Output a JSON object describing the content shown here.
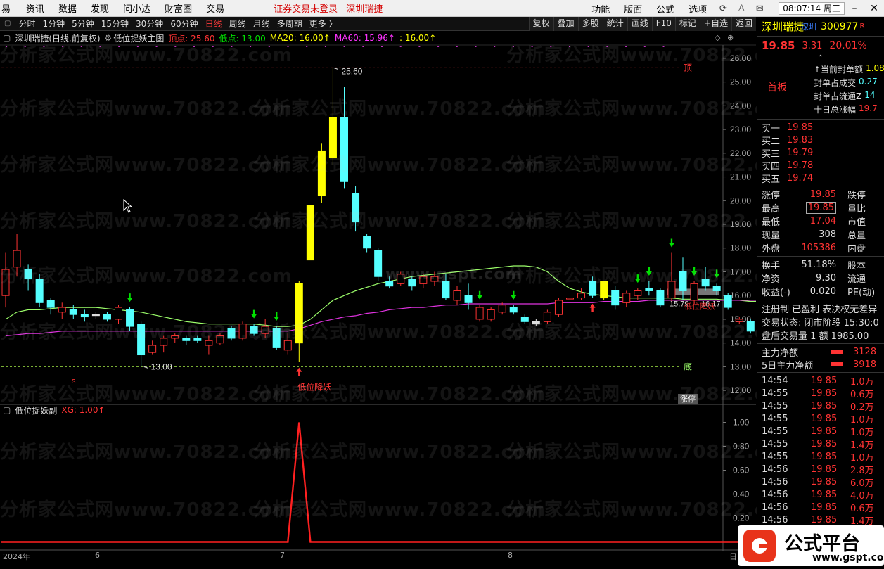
{
  "menu": {
    "items": [
      "易",
      "资讯",
      "数据",
      "发现",
      "问小达",
      "财富圈",
      "交易"
    ],
    "notice": [
      "证券交易未登录",
      "深圳瑞捷"
    ],
    "right_items": [
      "功能",
      "版面",
      "公式",
      "选项"
    ],
    "clock": "08:07:14 周三"
  },
  "toolbar": {
    "periods": [
      "分时",
      "1分钟",
      "5分钟",
      "15分钟",
      "30分钟",
      "60分钟",
      "日线",
      "周线",
      "月线",
      "多周期",
      "更多 〉"
    ],
    "active_period": "日线",
    "tools": [
      "复权",
      "叠加",
      "多股",
      "统计",
      "画线",
      "F10",
      "标记",
      "+自选",
      "返回"
    ]
  },
  "infobar": {
    "stock": "深圳瑞捷",
    "mode": "(日线,前复权)",
    "indicator": "低位捉妖主图",
    "top_label": "顶点: 25.60",
    "low_label": "低点: 13.00",
    "ma20_label": "MA20: 16.00↑",
    "ma60_label": "MA60: 15.96↑",
    "extra_label": ": 16.00↑"
  },
  "watermark": {
    "text": "分析家公式网www.70822.com",
    "site": "www.gspt.com"
  },
  "chart_annotations": {
    "peak_label": "25.60",
    "trough_label": "13.00",
    "top_line_label": "顶",
    "bottom_line_label": "底",
    "signal_label": "低位降妖",
    "signal_label_right": "低位降妖",
    "last_ma_label": "15.79",
    "last_close_label": "16.17",
    "zhangting_badge": "涨停",
    "s_marker": "s"
  },
  "chart_data": [
    {
      "type": "candlestick",
      "title": "低位捉妖主图",
      "yticks": [
        12.0,
        13.0,
        14.0,
        15.0,
        16.0,
        17.0,
        18.0,
        19.0,
        20.0,
        21.0,
        22.0,
        23.0,
        24.0,
        25.0,
        26.0
      ],
      "ylim": [
        11.5,
        26.5
      ],
      "candles": [
        [
          16.0,
          17.1,
          15.5,
          17.8,
          "r"
        ],
        [
          17.2,
          17.9,
          16.8,
          18.6,
          "r"
        ],
        [
          17.1,
          16.7,
          16.2,
          17.3,
          "c"
        ],
        [
          16.7,
          15.7,
          15.5,
          16.9,
          "c"
        ],
        [
          15.8,
          15.5,
          15.2,
          15.9,
          "c"
        ],
        [
          15.3,
          15.5,
          15.0,
          15.7,
          "r"
        ],
        [
          15.4,
          15.2,
          15.0,
          15.6,
          "c"
        ],
        [
          15.2,
          15.1,
          14.9,
          15.4,
          "c"
        ],
        [
          15.2,
          15.2,
          15.0,
          15.3,
          "w"
        ],
        [
          15.2,
          15.0,
          14.9,
          15.3,
          "c"
        ],
        [
          15.0,
          15.5,
          14.8,
          15.6,
          "r"
        ],
        [
          15.4,
          14.7,
          14.5,
          15.5,
          "c"
        ],
        [
          14.8,
          13.5,
          13.0,
          14.9,
          "c"
        ],
        [
          13.6,
          13.9,
          13.5,
          14.1,
          "r"
        ],
        [
          13.9,
          14.2,
          13.6,
          14.3,
          "r"
        ],
        [
          14.2,
          14.3,
          14.0,
          14.4,
          "r"
        ],
        [
          14.1,
          14.2,
          13.9,
          14.3,
          "c"
        ],
        [
          14.2,
          14.1,
          14.0,
          14.3,
          "c"
        ],
        [
          13.9,
          14.1,
          13.5,
          14.3,
          "r"
        ],
        [
          14.0,
          14.3,
          13.9,
          14.4,
          "r"
        ],
        [
          14.6,
          14.2,
          14.1,
          14.7,
          "c"
        ],
        [
          14.2,
          14.8,
          14.1,
          14.9,
          "r"
        ],
        [
          14.7,
          14.4,
          14.3,
          14.8,
          "c"
        ],
        [
          14.4,
          14.7,
          14.2,
          15.0,
          "r"
        ],
        [
          14.6,
          13.8,
          13.7,
          14.7,
          "c"
        ],
        [
          13.7,
          14.1,
          13.5,
          14.4,
          "r"
        ],
        [
          14.0,
          16.5,
          13.2,
          16.6,
          "y"
        ],
        [
          17.5,
          19.8,
          17.5,
          19.8,
          "y"
        ],
        [
          20.2,
          22.1,
          19.9,
          22.4,
          "y"
        ],
        [
          21.8,
          23.5,
          21.5,
          25.6,
          "y"
        ],
        [
          23.5,
          20.8,
          20.5,
          24.8,
          "c"
        ],
        [
          20.3,
          19.1,
          18.7,
          20.6,
          "c"
        ],
        [
          18.5,
          18.0,
          17.8,
          18.6,
          "c"
        ],
        [
          17.9,
          16.8,
          16.6,
          18.0,
          "c"
        ],
        [
          16.6,
          16.4,
          16.3,
          16.8,
          "c"
        ],
        [
          16.5,
          16.9,
          16.4,
          17.0,
          "r"
        ],
        [
          16.7,
          16.4,
          16.2,
          16.8,
          "c"
        ],
        [
          16.5,
          16.8,
          16.3,
          16.9,
          "r"
        ],
        [
          16.8,
          16.6,
          16.4,
          17.0,
          "r"
        ],
        [
          16.6,
          15.9,
          15.8,
          16.9,
          "c"
        ],
        [
          15.8,
          16.2,
          15.6,
          16.4,
          "r"
        ],
        [
          16.0,
          15.7,
          15.4,
          16.5,
          "c"
        ],
        [
          15.5,
          15.0,
          14.9,
          15.6,
          "r"
        ],
        [
          15.0,
          15.4,
          14.9,
          15.5,
          "r"
        ],
        [
          15.3,
          15.6,
          15.2,
          15.7,
          "r"
        ],
        [
          15.5,
          15.3,
          15.2,
          15.6,
          "c"
        ],
        [
          15.1,
          14.9,
          14.8,
          15.2,
          "c"
        ],
        [
          14.9,
          14.8,
          14.7,
          15.0,
          "w"
        ],
        [
          14.9,
          15.3,
          14.8,
          15.4,
          "r"
        ],
        [
          15.2,
          15.8,
          15.1,
          15.9,
          "r"
        ],
        [
          15.9,
          15.9,
          15.8,
          16.0,
          "r"
        ],
        [
          15.9,
          16.1,
          15.8,
          16.3,
          "r"
        ],
        [
          16.6,
          16.0,
          15.9,
          16.8,
          "c"
        ],
        [
          16.6,
          15.9,
          15.8,
          16.6,
          "y"
        ],
        [
          16.2,
          15.6,
          15.4,
          16.4,
          "c"
        ],
        [
          15.7,
          16.1,
          15.5,
          16.2,
          "r"
        ],
        [
          16.2,
          16.0,
          15.8,
          16.3,
          "r"
        ],
        [
          16.3,
          16.2,
          16.0,
          16.6,
          "c"
        ],
        [
          16.2,
          15.6,
          15.5,
          16.3,
          "c"
        ],
        [
          15.9,
          16.6,
          15.7,
          17.8,
          "r"
        ],
        [
          17.0,
          16.2,
          15.8,
          17.6,
          "c"
        ],
        [
          15.8,
          16.5,
          15.6,
          16.6,
          "r"
        ],
        [
          16.7,
          16.4,
          16.2,
          17.2,
          "c"
        ],
        [
          16.4,
          16.2,
          16.0,
          16.5,
          "c"
        ],
        [
          16.0,
          15.5,
          15.4,
          16.1,
          "c"
        ],
        [
          15.0,
          14.9,
          14.8,
          15.1,
          "r"
        ],
        [
          14.9,
          14.5,
          14.4,
          15.0,
          "c"
        ],
        [
          14.5,
          15.4,
          14.4,
          16.4,
          "r"
        ],
        [
          15.3,
          14.8,
          14.7,
          15.7,
          "c"
        ],
        [
          14.8,
          15.5,
          14.7,
          15.6,
          "r"
        ],
        [
          15.6,
          17.4,
          15.8,
          17.7,
          "y"
        ],
        [
          18.0,
          19.85,
          17.5,
          19.85,
          "y"
        ]
      ],
      "ma_green": [
        15.0,
        15.3,
        15.4,
        15.4,
        15.45,
        15.5,
        15.5,
        15.5,
        15.5,
        15.45,
        15.4,
        15.35,
        15.3,
        15.2,
        15.1,
        15.0,
        14.9,
        14.85,
        14.8,
        14.8,
        14.8,
        14.8,
        14.8,
        14.75,
        14.7,
        14.7,
        14.75,
        15.0,
        15.4,
        15.8,
        16.0,
        16.2,
        16.35,
        16.5,
        16.6,
        16.7,
        16.8,
        16.85,
        16.9,
        16.95,
        17.0,
        17.05,
        17.1,
        17.15,
        17.2,
        17.25,
        17.25,
        17.2,
        17.0,
        16.6,
        16.3,
        16.15,
        16.05,
        16.0,
        15.95,
        15.9,
        15.9,
        15.9,
        15.9,
        15.9,
        15.85,
        15.85,
        15.85,
        15.85,
        15.8,
        15.8,
        15.75,
        15.75,
        15.75,
        15.75,
        15.85,
        16.0
      ],
      "ma_magenta": [
        14.3,
        14.35,
        14.4,
        14.4,
        14.45,
        14.5,
        14.5,
        14.5,
        14.5,
        14.5,
        14.5,
        14.5,
        14.5,
        14.5,
        14.5,
        14.5,
        14.5,
        14.5,
        14.5,
        14.5,
        14.5,
        14.5,
        14.5,
        14.5,
        14.5,
        14.5,
        14.6,
        14.75,
        14.9,
        15.0,
        15.1,
        15.15,
        15.25,
        15.3,
        15.4,
        15.45,
        15.5,
        15.5,
        15.55,
        15.6,
        15.6,
        15.65,
        15.65,
        15.65,
        15.65,
        15.65,
        15.65,
        15.65,
        15.65,
        15.7,
        15.7,
        15.7,
        15.7,
        15.75,
        15.75,
        15.75,
        15.75,
        15.8,
        15.8,
        15.8,
        15.8,
        15.8,
        15.8,
        15.8,
        15.8,
        15.8,
        15.8,
        15.8,
        15.8,
        15.85,
        15.9,
        15.96
      ],
      "buy_signals_green": [
        11,
        22,
        24,
        42,
        45,
        56,
        57,
        59,
        61,
        63
      ],
      "buy_signals_red": [
        26,
        52,
        71
      ],
      "top_line": 25.6,
      "bottom_line": 13.0,
      "signal_line": 16.17
    },
    {
      "type": "line",
      "title": "低位捉妖副",
      "series": [
        {
          "name": "XG",
          "values": [
            0,
            0,
            0,
            0,
            0,
            0,
            0,
            0,
            0,
            0,
            0,
            0,
            0,
            0,
            0,
            0,
            0,
            0,
            0,
            0,
            0,
            0,
            0,
            0,
            0,
            0,
            1,
            0,
            0,
            0,
            0,
            0,
            0,
            0,
            0,
            0,
            0,
            0,
            0,
            0,
            0,
            0,
            0,
            0,
            0,
            0,
            0,
            0,
            0,
            0,
            0,
            0,
            0,
            0,
            0,
            0,
            0,
            0,
            0,
            0,
            0,
            0,
            0,
            0,
            0,
            0,
            0,
            0,
            0,
            0,
            0,
            1
          ]
        }
      ],
      "yticks": [
        0.2,
        0.4,
        0.6,
        0.8,
        1.0
      ],
      "ylim": [
        -0.05,
        1.05
      ],
      "legend_label": "XG: 1.00↑"
    }
  ],
  "xaxis": {
    "labels": [
      "2024年",
      "6",
      "7",
      "8",
      "日"
    ]
  },
  "panel": {
    "name": "深圳瑞捷",
    "market": "深圳",
    "code": "300977",
    "r_flag": "R",
    "price": "19.85",
    "change": "3.31",
    "change_pct": "20.01%",
    "tag": "首板",
    "seal_rows": [
      {
        "k": "↑当前封单额",
        "v": "1.08"
      },
      {
        "k": "封单占成交",
        "v": "0.27"
      },
      {
        "k": "封单占流通Z",
        "v": "14"
      },
      {
        "k": "十日总涨幅",
        "v": "19.7"
      }
    ],
    "orderbook": [
      {
        "k": "买一",
        "v": "19.85",
        "q": ""
      },
      {
        "k": "买二",
        "v": "19.83",
        "q": ""
      },
      {
        "k": "买三",
        "v": "19.79",
        "q": ""
      },
      {
        "k": "买四",
        "v": "19.78",
        "q": ""
      },
      {
        "k": "买五",
        "v": "19.74",
        "q": ""
      }
    ],
    "stats_a": [
      {
        "k": "涨停",
        "v": "19.85",
        "k2": "跌停",
        "vc": "red"
      },
      {
        "k": "最高",
        "v": "19.85",
        "k2": "量比",
        "vc": "red",
        "boxed": true
      },
      {
        "k": "最低",
        "v": "17.04",
        "k2": "市值",
        "vc": "red"
      },
      {
        "k": "现量",
        "v": "308",
        "k2": "总量",
        "vc": "white"
      },
      {
        "k": "外盘",
        "v": "105386",
        "k2": "内盘",
        "vc": "red"
      }
    ],
    "stats_b": [
      {
        "k": "换手",
        "v": "51.18%",
        "k2": "股本",
        "vc": "white"
      },
      {
        "k": "净资",
        "v": "9.30",
        "k2": "流通",
        "vc": "white"
      },
      {
        "k": "收益(-)",
        "v": "0.020",
        "k2": "PE(动)",
        "vc": "white"
      }
    ],
    "info": [
      "注册制 已盈利 表决权无差异",
      "交易状态: 闭市阶段 15:30:0",
      "盘后交易量 1 额 1985.00"
    ],
    "flow": [
      {
        "k": "主力净额",
        "v": "3128"
      },
      {
        "k": "5日主力净额",
        "v": "3918"
      }
    ],
    "ticks": [
      {
        "t": "14:54",
        "p": "19.85",
        "v": "1.0万"
      },
      {
        "t": "14:55",
        "p": "19.85",
        "v": "0.6万"
      },
      {
        "t": "14:55",
        "p": "19.85",
        "v": "0.2万"
      },
      {
        "t": "14:55",
        "p": "19.85",
        "v": "1.0万"
      },
      {
        "t": "14:55",
        "p": "19.85",
        "v": "1.0万"
      },
      {
        "t": "14:55",
        "p": "19.85",
        "v": "1.4万"
      },
      {
        "t": "14:55",
        "p": "19.85",
        "v": "1.0万"
      },
      {
        "t": "14:56",
        "p": "19.85",
        "v": "2.8万"
      },
      {
        "t": "14:56",
        "p": "19.85",
        "v": "6.0万"
      },
      {
        "t": "14:56",
        "p": "19.85",
        "v": "4.0万"
      },
      {
        "t": "14:56",
        "p": "19.85",
        "v": "0.6万"
      },
      {
        "t": "14:56",
        "p": "19.85",
        "v": "1.4万"
      },
      {
        "t": "14:56",
        "p": "19.85",
        "v": "1.0万"
      }
    ]
  },
  "logo": {
    "text": "公式平台",
    "sub": "www.gspt.com"
  },
  "colors": {
    "up": "#ff3333",
    "down": "#54ffff",
    "limit": "#ffff00",
    "ma_green": "#9dff6b",
    "ma_magenta": "#e033e0"
  }
}
